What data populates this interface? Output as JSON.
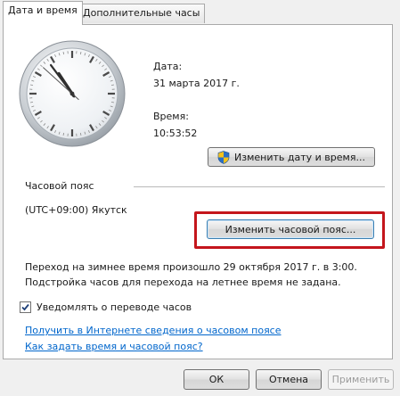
{
  "tabs": [
    {
      "label": "Дата и время",
      "active": true
    },
    {
      "label": "Дополнительные часы",
      "active": false
    }
  ],
  "date": {
    "label": "Дата:",
    "value": "31 марта 2017 г."
  },
  "time": {
    "label": "Время:",
    "value": "10:53:52"
  },
  "clock": {
    "hour": 10,
    "minute": 53,
    "second": 52
  },
  "change_datetime_button": "Изменить дату и время...",
  "timezone": {
    "header": "Часовой пояс",
    "value": "(UTC+09:00) Якутск",
    "change_button": "Изменить часовой пояс..."
  },
  "dst": {
    "line1": "Переход на зимнее время произошло 29 октября 2017 г. в 3:00.",
    "line2": "Подстройка часов для перехода на летнее время не задана."
  },
  "notify_checkbox": {
    "label": "Уведомлять о переводе часов",
    "checked": true
  },
  "links": {
    "online_info": "Получить в Интернете сведения о часовом поясе",
    "how_to": "Как задать время и часовой пояс?"
  },
  "footer": {
    "ok": "ОК",
    "cancel": "Отмена",
    "apply": "Применить"
  },
  "colors": {
    "highlight": "#c4161c",
    "link": "#0066cc"
  }
}
